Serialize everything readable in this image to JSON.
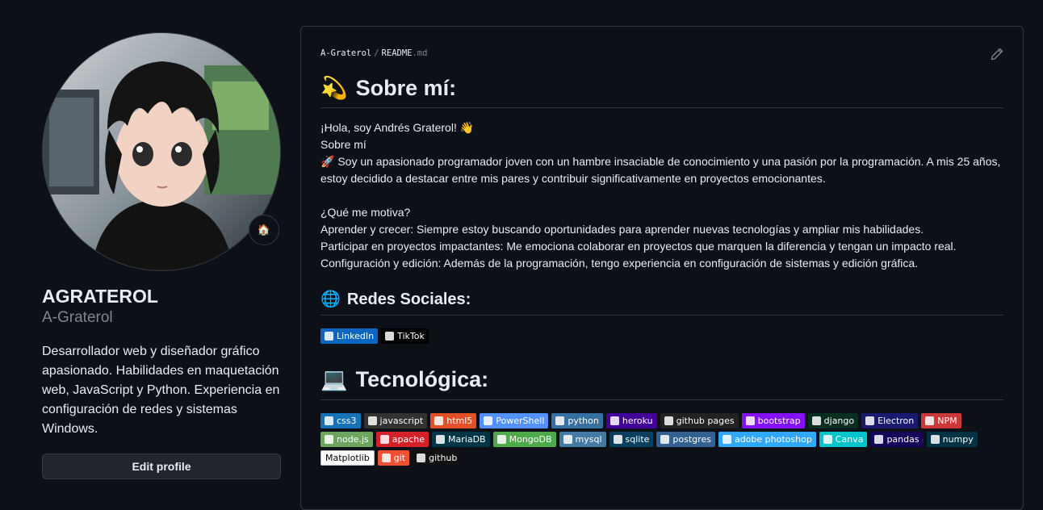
{
  "profile": {
    "fullname": "AGRATEROL",
    "username": "A-Graterol",
    "bio": "Desarrollador web y diseñador gráfico apasionado. Habilidades en maquetación web, JavaScript y Python. Experiencia en configuración de redes y sistemas Windows.",
    "edit_label": "Edit profile",
    "status_emoji": "🏠"
  },
  "readme": {
    "repo": "A-Graterol",
    "separator": "/",
    "file_base": "README",
    "file_ext": ".md",
    "about_emoji": "💫",
    "about_title": "Sobre mí:",
    "greeting": "¡Hola, soy Andrés Graterol! 👋",
    "about_sub": "Sobre mí",
    "about_text": "🚀 Soy un apasionado programador joven con un hambre insaciable de conocimiento y una pasión por la programación. A mis 25 años, estoy decidido a destacar entre mis pares y contribuir significativamente en proyectos emocionantes.",
    "motivation_title": "¿Qué me motiva?",
    "motivation_1": "Aprender y crecer: Siempre estoy buscando oportunidades para aprender nuevas tecnologías y ampliar mis habilidades.",
    "motivation_2": "Participar en proyectos impactantes: Me emociona colaborar en proyectos que marquen la diferencia y tengan un impacto real.",
    "motivation_3": "Configuración y edición: Además de la programación, tengo experiencia en configuración de sistemas y edición gráfica.",
    "social_emoji": "🌐",
    "social_title": "Redes Sociales:",
    "social_badges": [
      {
        "label": "LinkedIn",
        "color": "#0a66c2"
      },
      {
        "label": "TikTok",
        "color": "#000000"
      }
    ],
    "tech_emoji": "💻",
    "tech_title": "Tecnológica:",
    "tech_badges": [
      {
        "label": "css3",
        "color": "#1572b6"
      },
      {
        "label": "javascript",
        "color": "#323330"
      },
      {
        "label": "html5",
        "color": "#e34f26"
      },
      {
        "label": "PowerShell",
        "color": "#5391fe"
      },
      {
        "label": "python",
        "color": "#3670a0"
      },
      {
        "label": "heroku",
        "color": "#430098"
      },
      {
        "label": "github pages",
        "color": "#222222"
      },
      {
        "label": "bootstrap",
        "color": "#8511fa"
      },
      {
        "label": "django",
        "color": "#092e20"
      },
      {
        "label": "Electron",
        "color": "#191970"
      },
      {
        "label": "NPM",
        "color": "#cb3837"
      },
      {
        "label": "node.js",
        "color": "#6da55f"
      },
      {
        "label": "apache",
        "color": "#d42029"
      },
      {
        "label": "MariaDB",
        "color": "#003545"
      },
      {
        "label": "MongoDB",
        "color": "#4ea94b"
      },
      {
        "label": "mysql",
        "color": "#4479a1"
      },
      {
        "label": "sqlite",
        "color": "#07405e"
      },
      {
        "label": "postgres",
        "color": "#316192"
      },
      {
        "label": "adobe photoshop",
        "color": "#31a8ff"
      },
      {
        "label": "Canva",
        "color": "#00c4cc"
      },
      {
        "label": "pandas",
        "color": "#150458"
      },
      {
        "label": "numpy",
        "color": "#013243"
      },
      {
        "label": "Matplotlib",
        "color": "#ffffff"
      },
      {
        "label": "git",
        "color": "#f05033"
      },
      {
        "label": "github",
        "color": "#121011"
      }
    ]
  }
}
